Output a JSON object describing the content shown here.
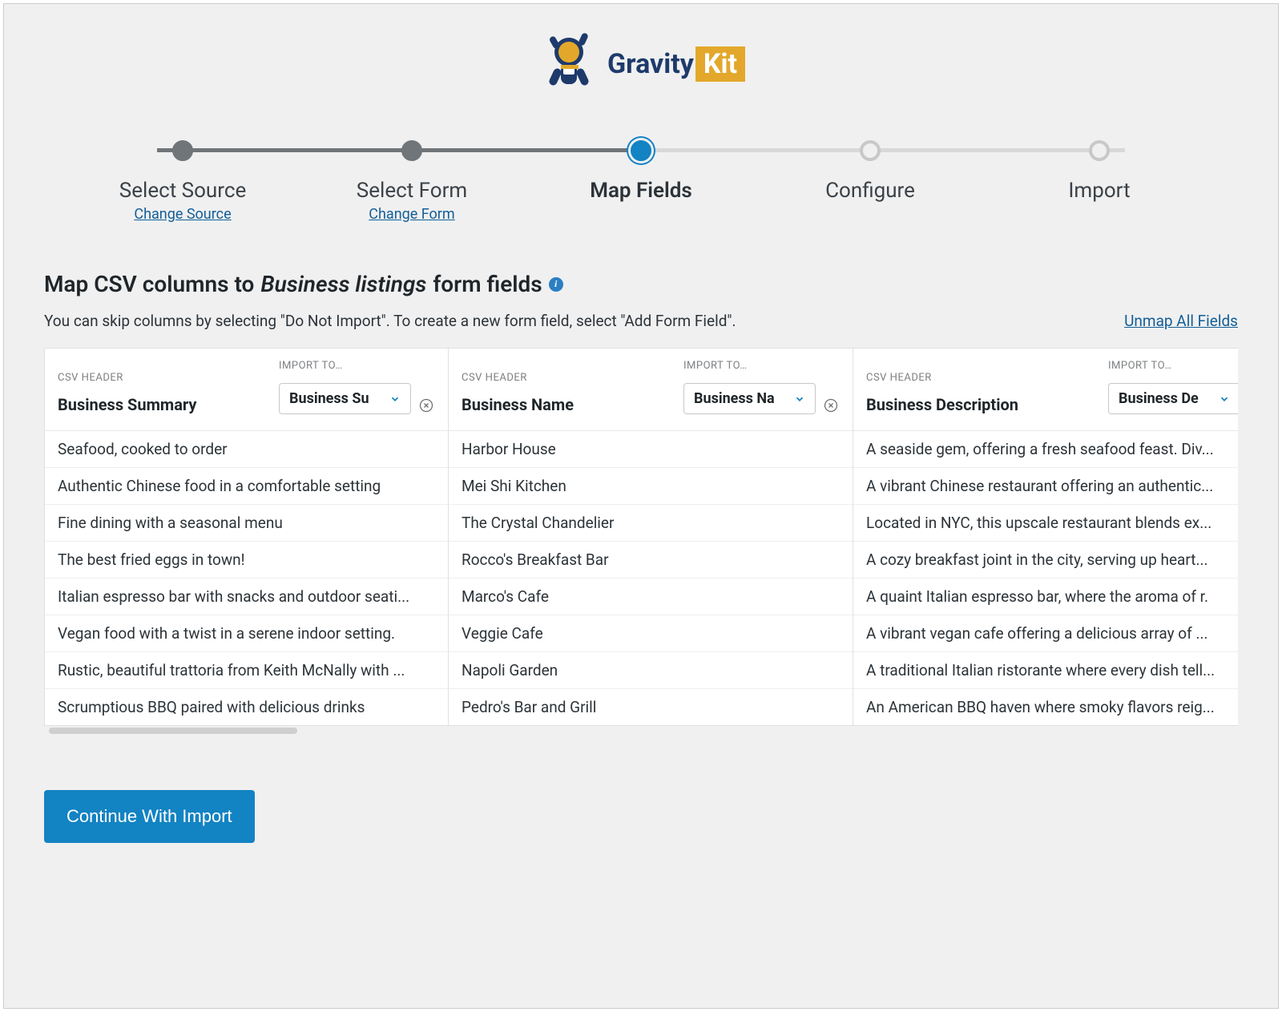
{
  "brand": {
    "name_a": "Gravity",
    "name_b": "Kit"
  },
  "steps": [
    {
      "label": "Select Source",
      "link": "Change Source",
      "state": "done"
    },
    {
      "label": "Select Form",
      "link": "Change Form",
      "state": "done"
    },
    {
      "label": "Map Fields",
      "link": "",
      "state": "active"
    },
    {
      "label": "Configure",
      "link": "",
      "state": "pending"
    },
    {
      "label": "Import",
      "link": "",
      "state": "pending"
    }
  ],
  "heading": {
    "prefix": "Map CSV columns to ",
    "form_name": "Business listings",
    "suffix": " form fields"
  },
  "help_text": "You can skip columns by selecting \"Do Not Import\". To create a new form field, select \"Add Form Field\".",
  "unmap_link": "Unmap All Fields",
  "labels": {
    "csv_header": "CSV HEADER",
    "import_to": "IMPORT TO…"
  },
  "columns": [
    {
      "csv_header": "Business Summary",
      "import_to": "Business Su"
    },
    {
      "csv_header": "Business Name",
      "import_to": "Business Na"
    },
    {
      "csv_header": "Business Description",
      "import_to": "Business De"
    }
  ],
  "rows": [
    {
      "c0": "Seafood, cooked to order",
      "c1": "Harbor House",
      "c2": "A seaside gem, offering a fresh seafood feast. Div..."
    },
    {
      "c0": "Authentic Chinese food in a comfortable setting",
      "c1": "Mei Shi Kitchen",
      "c2": "A vibrant Chinese restaurant offering an authentic..."
    },
    {
      "c0": "Fine dining with a seasonal menu",
      "c1": "The Crystal Chandelier",
      "c2": "Located in NYC, this upscale restaurant blends ex..."
    },
    {
      "c0": "The best fried eggs in town!",
      "c1": "Rocco's Breakfast Bar",
      "c2": "A cozy breakfast joint in the city, serving up heart..."
    },
    {
      "c0": "Italian espresso bar with snacks and outdoor seati...",
      "c1": "Marco's Cafe",
      "c2": "A quaint Italian espresso bar, where the aroma of r."
    },
    {
      "c0": "Vegan food with a twist in a serene indoor setting.",
      "c1": "Veggie Cafe",
      "c2": "A vibrant vegan cafe offering a delicious array of ..."
    },
    {
      "c0": "Rustic, beautiful trattoria from Keith McNally with ...",
      "c1": "Napoli Garden",
      "c2": "A traditional Italian ristorante where every dish tell..."
    },
    {
      "c0": "Scrumptious BBQ paired with delicious drinks",
      "c1": "Pedro's Bar and Grill",
      "c2": "An American BBQ haven where smoky flavors reig..."
    }
  ],
  "primary_button": "Continue With Import"
}
